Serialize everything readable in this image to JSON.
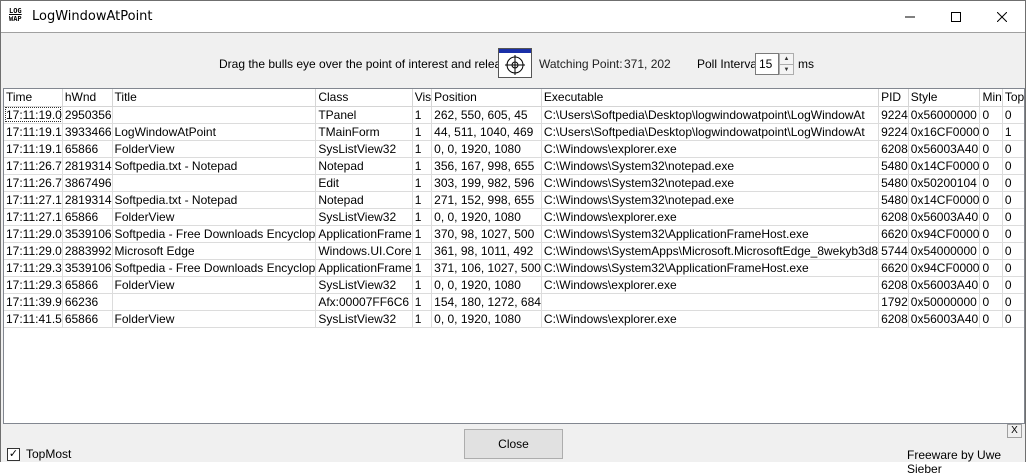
{
  "window": {
    "title": "LogWindowAtPoint",
    "icon_text_line1": "LOG",
    "icon_text_line2": "WAP"
  },
  "toolbar": {
    "drag_text": "Drag the bulls eye over the point of interest and release it:",
    "watching_label": "Watching Point:",
    "watching_value": "371, 202",
    "poll_label": "Poll Interval:",
    "poll_value": "15",
    "ms_label": "ms"
  },
  "table": {
    "columns": [
      "Time",
      "hWnd",
      "Title",
      "Class",
      "Vis",
      "Position",
      "Executable",
      "PID",
      "Style",
      "Min",
      "Top"
    ],
    "rows": [
      [
        "17:11:19.0",
        "2950356",
        "",
        "TPanel",
        "1",
        "262, 550, 605, 45",
        "C:\\Users\\Softpedia\\Desktop\\logwindowatpoint\\LogWindowAt",
        "9224",
        "0x56000000",
        "0",
        "0"
      ],
      [
        "17:11:19.1",
        "3933466",
        "LogWindowAtPoint",
        "TMainForm",
        "1",
        "44, 511, 1040, 469",
        "C:\\Users\\Softpedia\\Desktop\\logwindowatpoint\\LogWindowAt",
        "9224",
        "0x16CF0000",
        "0",
        "1"
      ],
      [
        "17:11:19.1",
        "65866",
        "FolderView",
        "SysListView32",
        "1",
        "0, 0, 1920, 1080",
        "C:\\Windows\\explorer.exe",
        "6208",
        "0x56003A40",
        "0",
        "0"
      ],
      [
        "17:11:26.7",
        "2819314",
        "Softpedia.txt - Notepad",
        "Notepad",
        "1",
        "356, 167, 998, 655",
        "C:\\Windows\\System32\\notepad.exe",
        "5480",
        "0x14CF0000",
        "0",
        "0"
      ],
      [
        "17:11:26.7",
        "3867496",
        "",
        "Edit",
        "1",
        "303, 199, 982, 596",
        "C:\\Windows\\System32\\notepad.exe",
        "5480",
        "0x50200104",
        "0",
        "0"
      ],
      [
        "17:11:27.1",
        "2819314",
        "Softpedia.txt - Notepad",
        "Notepad",
        "1",
        "271, 152, 998, 655",
        "C:\\Windows\\System32\\notepad.exe",
        "5480",
        "0x14CF0000",
        "0",
        "0"
      ],
      [
        "17:11:27.1",
        "65866",
        "FolderView",
        "SysListView32",
        "1",
        "0, 0, 1920, 1080",
        "C:\\Windows\\explorer.exe",
        "6208",
        "0x56003A40",
        "0",
        "0"
      ],
      [
        "17:11:29.0",
        "3539106",
        "Softpedia - Free Downloads Encyclop",
        "ApplicationFrame",
        "1",
        "370, 98, 1027, 500",
        "C:\\Windows\\System32\\ApplicationFrameHost.exe",
        "6620",
        "0x94CF0000",
        "0",
        "0"
      ],
      [
        "17:11:29.0",
        "2883992",
        "Microsoft Edge",
        "Windows.UI.Core",
        "1",
        "361, 98, 1011, 492",
        "C:\\Windows\\SystemApps\\Microsoft.MicrosoftEdge_8wekyb3d8",
        "5744",
        "0x54000000",
        "0",
        "0"
      ],
      [
        "17:11:29.3",
        "3539106",
        "Softpedia - Free Downloads Encyclop",
        "ApplicationFrame",
        "1",
        "371, 106, 1027, 500",
        "C:\\Windows\\System32\\ApplicationFrameHost.exe",
        "6620",
        "0x94CF0000",
        "0",
        "0"
      ],
      [
        "17:11:29.3",
        "65866",
        "FolderView",
        "SysListView32",
        "1",
        "0, 0, 1920, 1080",
        "C:\\Windows\\explorer.exe",
        "6208",
        "0x56003A40",
        "0",
        "0"
      ],
      [
        "17:11:39.9",
        "66236",
        "",
        "Afx:00007FF6C6",
        "1",
        "154, 180, 1272, 684",
        "",
        "1792",
        "0x50000000",
        "0",
        "0"
      ],
      [
        "17:11:41.5",
        "65866",
        "FolderView",
        "SysListView32",
        "1",
        "0, 0, 1920, 1080",
        "C:\\Windows\\explorer.exe",
        "6208",
        "0x56003A40",
        "0",
        "0"
      ]
    ]
  },
  "bottom": {
    "topmost_label": "TopMost",
    "topmost_checked": true,
    "close_label": "Close",
    "credit": "Freeware by Uwe Sieber",
    "corner_close": "X"
  },
  "colors": {
    "bullseye_bar": "#1a2fa8",
    "chrome_bg": "#f0f0f0"
  }
}
